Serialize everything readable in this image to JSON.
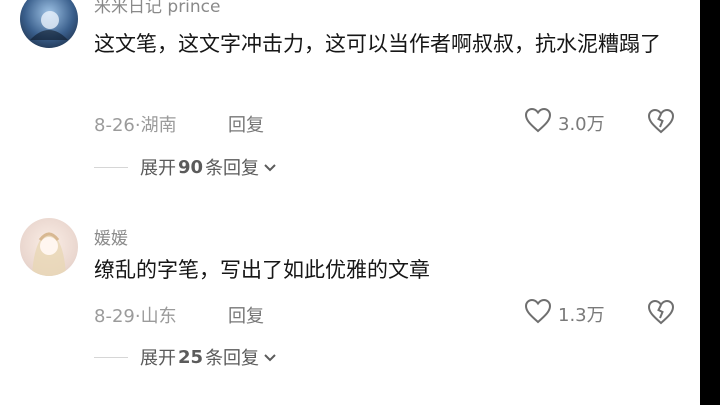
{
  "comments": [
    {
      "username": "米米日记 prince",
      "text": "这文笔，这文字冲击力，这可以当作者啊叔叔，抗水泥糟蹋了",
      "date_location": "8-26·湖南",
      "reply_label": "回复",
      "likes": "3.0万",
      "expand": {
        "prefix": "展开",
        "count": "90",
        "suffix": "条回复"
      }
    },
    {
      "username": "媛媛",
      "text": "缭乱的字笔，写出了如此优雅的文章",
      "date_location": "8-29·山东",
      "reply_label": "回复",
      "likes": "1.3万",
      "expand": {
        "prefix": "展开",
        "count": "25",
        "suffix": "条回复"
      }
    }
  ],
  "icons": {
    "like": "heart-outline-icon",
    "dislike": "broken-heart-icon",
    "expand": "chevron-down-icon"
  }
}
